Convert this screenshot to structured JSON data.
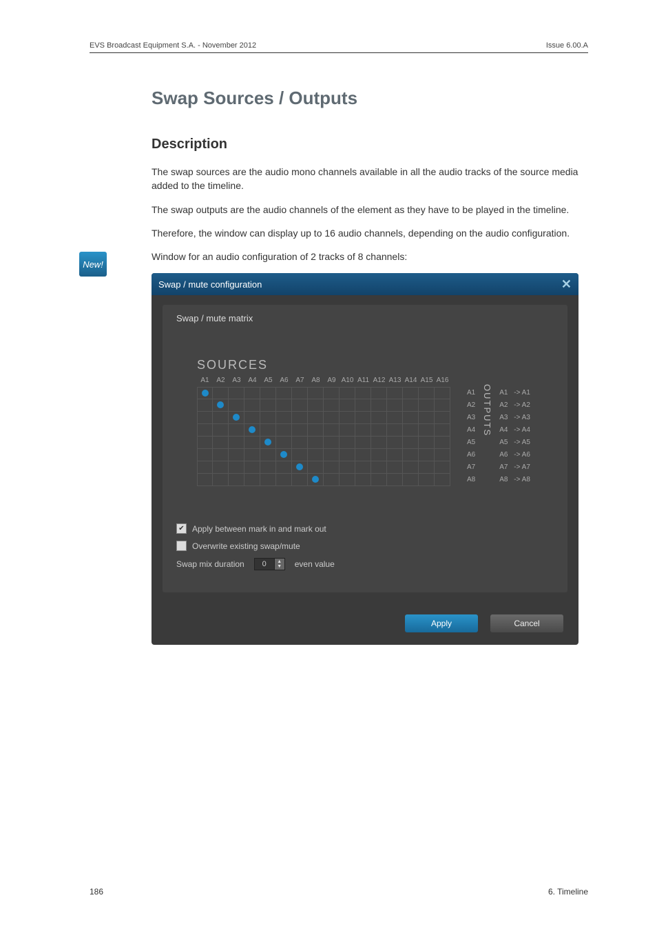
{
  "header": {
    "left": "EVS Broadcast Equipment S.A. - November 2012",
    "right": "Issue 6.00.A"
  },
  "badge": "New!",
  "section_title": "Swap Sources / Outputs",
  "sub_title": "Description",
  "paragraphs": {
    "p1": "The swap sources are the audio mono channels available in all the audio tracks of the source media added to the timeline.",
    "p2": "The swap outputs are the audio channels of the element as they have to be played in the timeline.",
    "p3": "Therefore, the window can display up to 16 audio channels, depending on the audio configuration.",
    "p4": "Window for an audio configuration of 2 tracks of 8 channels:"
  },
  "dialog": {
    "title": "Swap / mute configuration",
    "panel_title": "Swap / mute matrix",
    "sources_label": "SOURCES",
    "outputs_label": "OUTPUTS",
    "columns": [
      "A1",
      "A2",
      "A3",
      "A4",
      "A5",
      "A6",
      "A7",
      "A8",
      "A9",
      "A10",
      "A11",
      "A12",
      "A13",
      "A14",
      "A15",
      "A16"
    ],
    "rows": [
      "A1",
      "A2",
      "A3",
      "A4",
      "A5",
      "A6",
      "A7",
      "A8"
    ],
    "mappings": [
      {
        "out": "A1",
        "src": "A1"
      },
      {
        "out": "A2",
        "src": "A2"
      },
      {
        "out": "A3",
        "src": "A3"
      },
      {
        "out": "A4",
        "src": "A4"
      },
      {
        "out": "A5",
        "src": "A5"
      },
      {
        "out": "A6",
        "src": "A6"
      },
      {
        "out": "A7",
        "src": "A7"
      },
      {
        "out": "A8",
        "src": "A8"
      }
    ],
    "opt_apply_label": "Apply between mark in and mark out",
    "opt_apply_checked": true,
    "opt_overwrite_label": "Overwrite existing swap/mute",
    "opt_overwrite_checked": false,
    "swap_mix_label": "Swap mix duration",
    "swap_mix_value": "0",
    "swap_mix_hint": "even value",
    "apply_btn": "Apply",
    "cancel_btn": "Cancel"
  },
  "footer": {
    "left": "186",
    "right": "6. Timeline"
  }
}
